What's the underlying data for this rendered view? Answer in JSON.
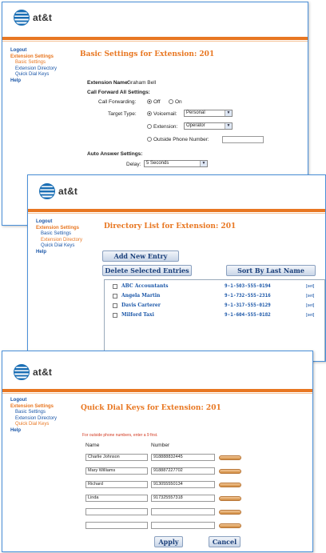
{
  "brand": "at&t",
  "nav": {
    "logout": "Logout",
    "extension_settings": "Extension Settings",
    "basic_settings": "Basic Settings",
    "extension_directory": "Extension Directory",
    "quick_dial_keys": "Quick Dial Keys",
    "help": "Help"
  },
  "basic": {
    "title": "Basic Settings for Extension: 201",
    "extension_name_label": "Extension Name:",
    "extension_name_value": "Graham Bell",
    "cfa_label": "Call Forward All Settings:",
    "call_forwarding_label": "Call Forwarding:",
    "off_label": "Off",
    "on_label": "On",
    "target_type_label": "Target Type:",
    "voicemail_label": "Voicemail:",
    "voicemail_value": "Personal",
    "extension_label": "Extension:",
    "extension_value": "Operator",
    "outside_label": "Outside Phone Number:",
    "outside_value": "",
    "auto_answer_label": "Auto Answer Settings:",
    "delay_label": "Delay:",
    "delay_value": "5 Seconds"
  },
  "directory": {
    "title": "Directory List for Extension: 201",
    "add_button": "Add New Entry",
    "delete_button": "Delete Selected Entries",
    "sort_button": "Sort By Last Name",
    "entries": [
      {
        "name": "ABC Accountants",
        "number": "9-1-503-555-0194",
        "action": "[set]"
      },
      {
        "name": "Angela Martin",
        "number": "9-1-732-555-2316",
        "action": "[set]"
      },
      {
        "name": "Davis Carterer",
        "number": "9-1-317-555-0129",
        "action": "[set]"
      },
      {
        "name": "Milford Taxi",
        "number": "9-1-604-555-0182",
        "action": "[set]"
      }
    ]
  },
  "quickdial": {
    "title": "Quick Dial Keys for Extension: 201",
    "note": "For outside phone numbers, enter a 9 first.",
    "col_name": "Name",
    "col_number": "Number",
    "rows": [
      {
        "name": "Charlie Johnson",
        "number": "918888832445"
      },
      {
        "name": "Mary Williams",
        "number": "918887227702"
      },
      {
        "name": "Richard",
        "number": "913055550134"
      },
      {
        "name": "Linda",
        "number": "917325557318"
      },
      {
        "name": "",
        "number": ""
      },
      {
        "name": "",
        "number": ""
      }
    ],
    "apply_button": "Apply",
    "cancel_button": "Cancel"
  }
}
